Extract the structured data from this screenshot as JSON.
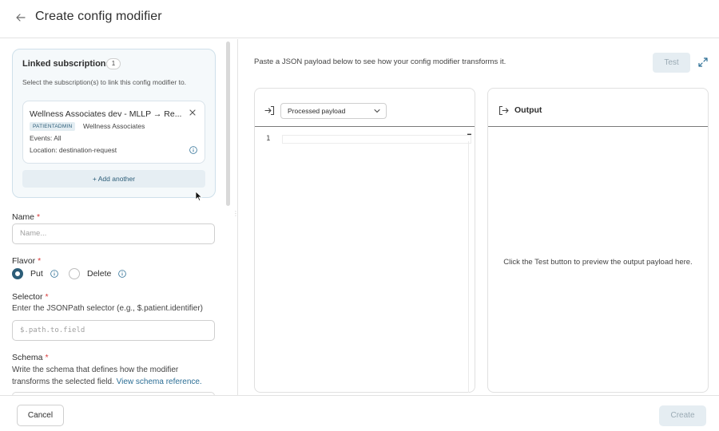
{
  "header": {
    "title": "Create config modifier",
    "back_icon": "arrow-left-icon"
  },
  "linked": {
    "title": "Linked subscriptions",
    "count": "1",
    "description": "Select the subscription(s) to link this config modifier to.",
    "subscription": {
      "name": "Wellness Associates dev - MLLP → Re...",
      "tag": "PATIENTADMIN",
      "org": "Wellness Associates",
      "events": "Events: All",
      "location": "Location: destination-request"
    },
    "add_label": "+   Add another"
  },
  "form": {
    "name_label": "Name",
    "name_placeholder": "Name...",
    "required_mark": "*",
    "flavor_label": "Flavor",
    "flavor_options": [
      {
        "label": "Put",
        "selected": true
      },
      {
        "label": "Delete",
        "selected": false
      }
    ],
    "selector_label": "Selector",
    "selector_help": "Enter the JSONPath selector (e.g., $.patient.identifier)",
    "selector_placeholder": "$.path.to.field",
    "schema_label": "Schema",
    "schema_help_line1": "Write the schema that defines how the modifier",
    "schema_help_line2": "transforms the selected field.",
    "schema_link": "View schema reference."
  },
  "preview": {
    "description": "Paste a JSON payload below to see how your config modifier transforms it.",
    "test_label": "Test",
    "input_select_value": "Processed payload",
    "line_number": "1",
    "output_title": "Output",
    "output_empty": "Click the Test button to preview the output payload here."
  },
  "footer": {
    "cancel_label": "Cancel",
    "create_label": "Create"
  },
  "colors": {
    "accent": "#2c5d78",
    "link": "#2c6e95",
    "required": "#d93b3b",
    "disabled_bg": "#e5edf2",
    "card_bg": "#f5f9fb"
  }
}
